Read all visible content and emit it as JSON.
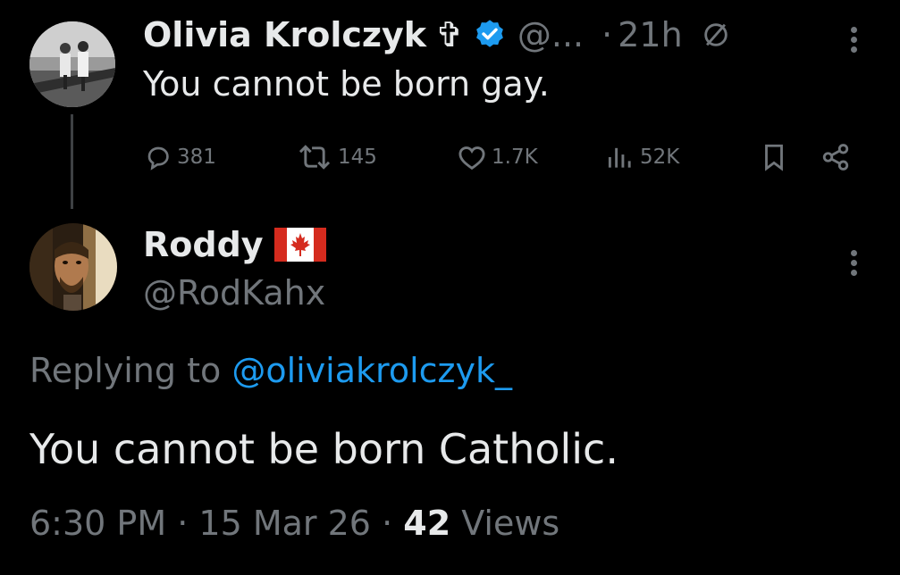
{
  "parent_post": {
    "author_name": "Olivia Krolczyk",
    "cross_symbol": "✞",
    "handle": "@...",
    "separator": "·",
    "time": "21h",
    "text": "You cannot be born gay.",
    "actions": {
      "replies": "381",
      "reposts": "145",
      "likes": "1.7K",
      "views": "52K"
    }
  },
  "reply_post": {
    "author_name": "Roddy",
    "handle": "@RodKahx",
    "replying_to_label": "Replying to",
    "replying_to_handle": "@oliviakrolczyk_",
    "text": "You cannot be born Catholic.",
    "time": "6:30 PM",
    "separator1": "·",
    "date": "15 Mar 26",
    "separator2": "·",
    "views_count": "42",
    "views_label": "Views"
  },
  "colors": {
    "background": "#000000",
    "text": "#e7e9ea",
    "secondary": "#71767b",
    "link": "#1d9bf0",
    "verified": "#1d9bf0"
  }
}
